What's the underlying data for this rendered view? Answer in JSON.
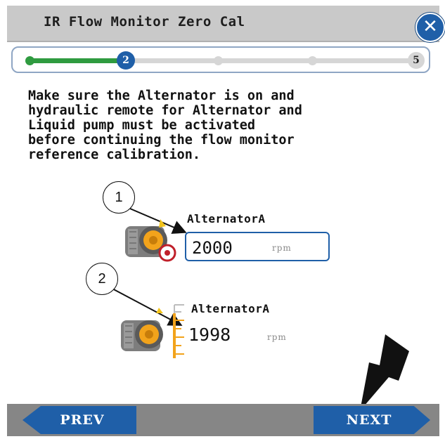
{
  "header": {
    "title": "IR Flow Monitor Zero Cal",
    "close_icon": "close-icon"
  },
  "progress": {
    "current_step": "2",
    "last_step": "5",
    "fraction_complete": 0.25,
    "accent_color": "#2f9b40"
  },
  "instructions": "Make sure the Alternator is on and\nhydraulic remote for Alternator and\nLiquid pump must be activated\nbefore continuing the flow monitor\nreference calibration.",
  "callouts": [
    "1",
    "2"
  ],
  "alternator_target": {
    "label": "AlternatorA",
    "value": "2000",
    "unit": "rpm",
    "icon": "alternator-target-icon"
  },
  "alternator_actual": {
    "label": "AlternatorA",
    "value": "1998",
    "unit": "rpm",
    "icon": "alternator-gauge-icon"
  },
  "footer": {
    "prev_label": "PREV",
    "next_label": "NEXT"
  },
  "colors": {
    "brand_blue": "#1f5fa8",
    "header_gray": "#c9c9c9",
    "footer_gray": "#868686",
    "gauge_orange": "#f2a31b"
  }
}
